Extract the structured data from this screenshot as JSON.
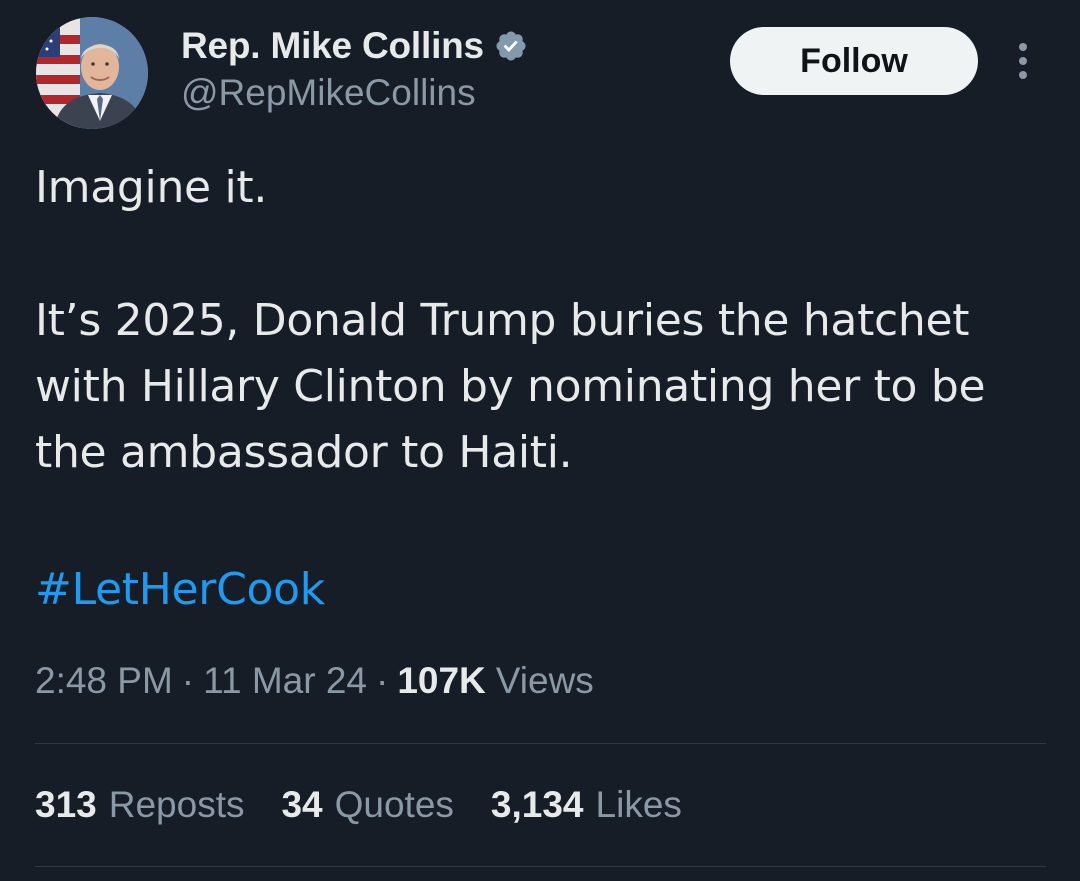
{
  "author": {
    "display_name": "Rep. Mike Collins",
    "handle": "@RepMikeCollins",
    "avatar_icon": "profile-photo",
    "verified_icon": "verified-badge-icon",
    "verified_color": "#829aab"
  },
  "header": {
    "follow_label": "Follow",
    "more_icon": "more-vertical-icon"
  },
  "tweet": {
    "paragraph_1": "Imagine it.",
    "paragraph_2_line_1": "It’s 2025, Donald Trump buries the hatchet",
    "paragraph_2_line_2": "with Hillary Clinton by nominating her to be",
    "paragraph_2_line_3": "the ambassador to Haiti.",
    "hashtag": "#LetHerCook"
  },
  "meta": {
    "time": "2:48 PM",
    "separator": "·",
    "date": "11 Mar 24",
    "views_count": "107K",
    "views_label": "Views"
  },
  "stats": [
    {
      "count": "313",
      "label": "Reposts"
    },
    {
      "count": "34",
      "label": "Quotes"
    },
    {
      "count": "3,134",
      "label": "Likes"
    }
  ],
  "colors": {
    "background": "#161d27",
    "primary_text": "#e7e9ea",
    "secondary_text": "#8b98a5",
    "link": "#1d9bf0",
    "follow_button_bg": "#eff3f4",
    "divider": "#2f3943"
  }
}
